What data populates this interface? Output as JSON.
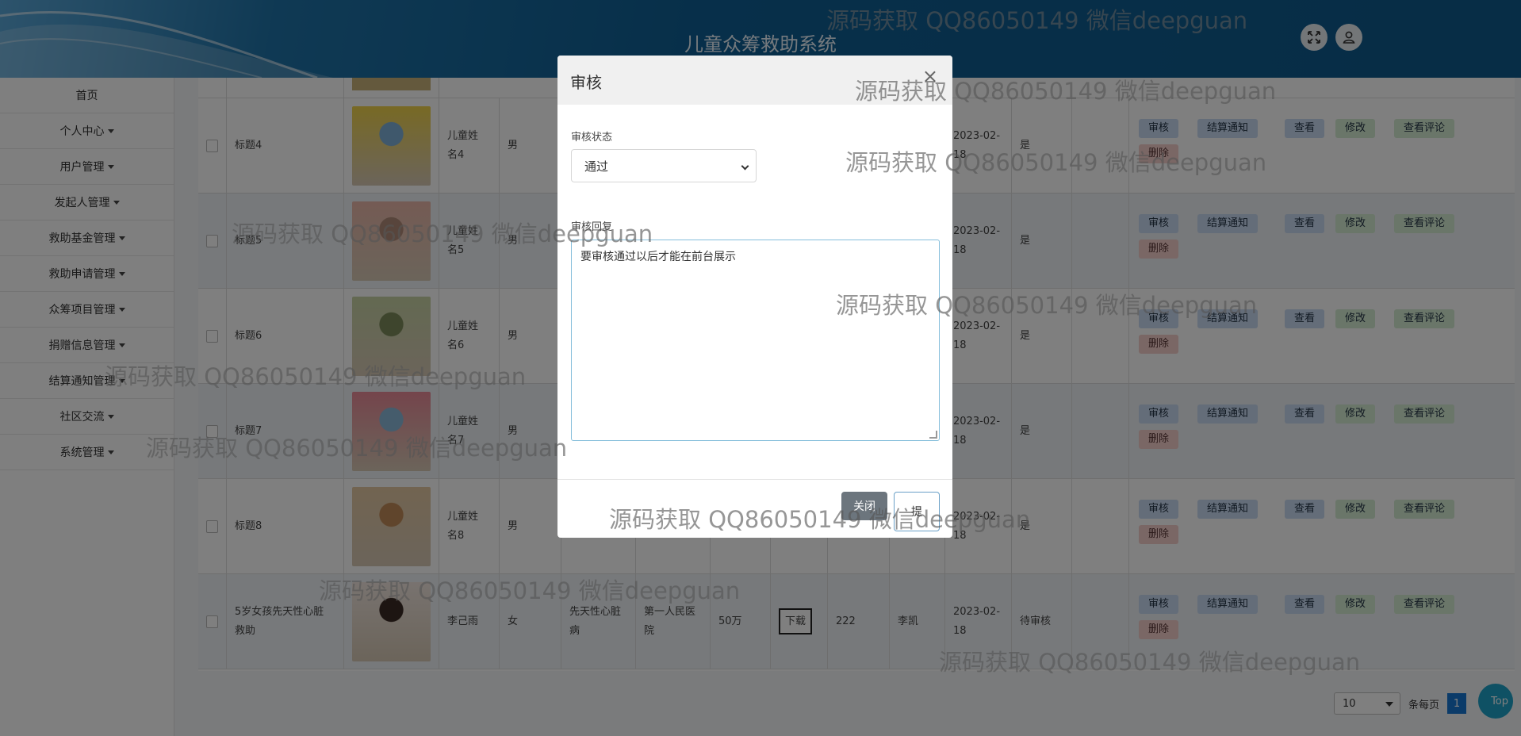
{
  "header": {
    "title": "儿童众筹救助系统"
  },
  "sidebar": {
    "items": [
      {
        "label": "首页",
        "dropdown": false
      },
      {
        "label": "个人中心",
        "dropdown": true
      },
      {
        "label": "用户管理",
        "dropdown": true
      },
      {
        "label": "发起人管理",
        "dropdown": true
      },
      {
        "label": "救助基金管理",
        "dropdown": true
      },
      {
        "label": "救助申请管理",
        "dropdown": true
      },
      {
        "label": "众筹项目管理",
        "dropdown": true
      },
      {
        "label": "捐赠信息管理",
        "dropdown": true
      },
      {
        "label": "结算通知管理",
        "dropdown": true
      },
      {
        "label": "社区交流",
        "dropdown": true
      },
      {
        "label": "系统管理",
        "dropdown": true
      }
    ]
  },
  "table": {
    "rows": [
      {
        "title": "标题4",
        "child_name": [
          "儿童姓",
          "名4"
        ],
        "gender": "男",
        "date": [
          "2023-02-",
          "18"
        ],
        "status": "是",
        "actions": [
          "审核",
          "结算通知",
          "查看",
          "修改",
          "查看评论",
          "删除"
        ]
      },
      {
        "title": "标题5",
        "child_name": [
          "儿童姓",
          "名5"
        ],
        "gender": "男",
        "date": [
          "2023-02-",
          "18"
        ],
        "status": "是",
        "actions": [
          "审核",
          "结算通知",
          "查看",
          "修改",
          "查看评论",
          "删除"
        ]
      },
      {
        "title": "标题6",
        "child_name": [
          "儿童姓",
          "名6"
        ],
        "gender": "男",
        "date": [
          "2023-02-",
          "18"
        ],
        "status": "是",
        "actions": [
          "审核",
          "结算通知",
          "查看",
          "修改",
          "查看评论",
          "删除"
        ]
      },
      {
        "title": "标题7",
        "child_name": [
          "儿童姓",
          "名7"
        ],
        "gender": "男",
        "date": [
          "2023-02-",
          "18"
        ],
        "status": "是",
        "actions": [
          "审核",
          "结算通知",
          "查看",
          "修改",
          "查看评论",
          "删除"
        ]
      },
      {
        "title": "标题8",
        "child_name": [
          "儿童姓",
          "名8"
        ],
        "gender": "男",
        "date": [
          "2023-02-",
          "18"
        ],
        "status": "是",
        "actions": [
          "审核",
          "结算通知",
          "查看",
          "修改",
          "查看评论",
          "删除"
        ]
      },
      {
        "title": [
          "5岁女孩先天性心脏",
          "救助"
        ],
        "child_name": [
          "李己雨"
        ],
        "gender": "女",
        "disease": [
          "先天性心脏",
          "病"
        ],
        "hospital": [
          "第一人民医",
          "院"
        ],
        "amount": "50万",
        "download": "下载",
        "count": "222",
        "sponsor": "李凯",
        "date": [
          "2023-02-",
          "18"
        ],
        "status": "待审核",
        "actions": [
          "审核",
          "结算通知",
          "查看",
          "修改",
          "查看评论",
          "删除"
        ]
      }
    ]
  },
  "pagination": {
    "page_size": "10",
    "per_page_label": "条每页",
    "current_page": "1",
    "top_label": "Top"
  },
  "modal": {
    "title": "审核",
    "close_x": "×",
    "status_label": "审核状态",
    "status_value": "通过",
    "reply_label": "审核回复",
    "reply_value": "要审核通过以后才能在前台展示",
    "close_button": "关闭",
    "submit_button": "提"
  },
  "watermark": "源码获取 QQ86050149 微信deepguan"
}
